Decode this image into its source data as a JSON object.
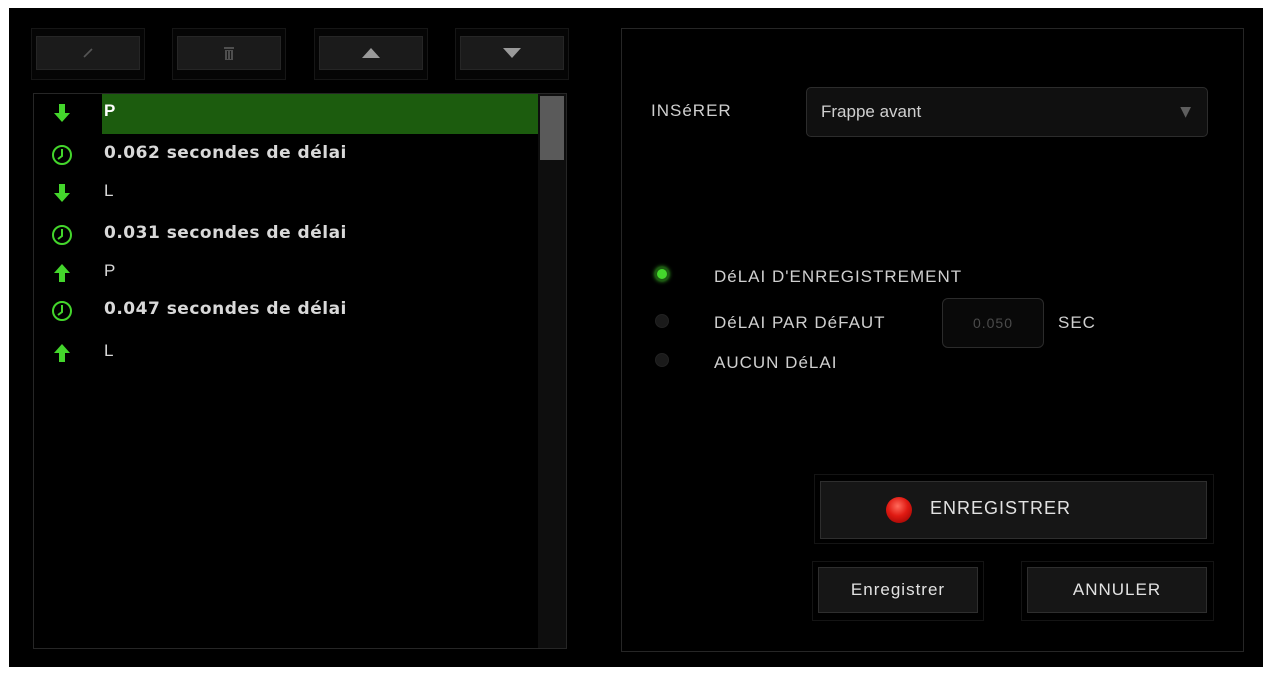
{
  "toolbar": {
    "buttons": [
      {
        "name": "edit-button",
        "icon": "pencil-icon"
      },
      {
        "name": "delete-button",
        "icon": "trash-icon"
      },
      {
        "name": "move-up-button",
        "icon": "triangle-up-icon"
      },
      {
        "name": "move-down-button",
        "icon": "triangle-down-icon"
      }
    ]
  },
  "macro_list": {
    "items": [
      {
        "type": "key-down",
        "icon": "arrow-down-icon",
        "text": "P",
        "selected": true
      },
      {
        "type": "delay",
        "icon": "clock-icon",
        "text": "0.062 secondes de délai"
      },
      {
        "type": "key-down",
        "icon": "arrow-down-icon",
        "text": "L"
      },
      {
        "type": "delay",
        "icon": "clock-icon",
        "text": "0.031 secondes de délai"
      },
      {
        "type": "key-up",
        "icon": "arrow-up-icon",
        "text": "P"
      },
      {
        "type": "delay",
        "icon": "clock-icon",
        "text": "0.047 secondes de délai"
      },
      {
        "type": "key-up",
        "icon": "arrow-up-icon",
        "text": "L"
      }
    ]
  },
  "insert": {
    "label": "INSéRER",
    "selected": "Frappe avant"
  },
  "delay_options": {
    "record": "DéLAI D'ENREGISTREMENT",
    "default": "DéLAI PAR DéFAUT",
    "default_value": "0.050",
    "unit": "SEC",
    "none": "AUCUN DéLAI",
    "selected": "record"
  },
  "actions": {
    "record": "ENREGISTRER",
    "save": "Enregistrer",
    "cancel": "ANNULER"
  },
  "colors": {
    "accent": "#44d62c",
    "selection": "#1c5c0e",
    "record_dot": "#e01a12"
  }
}
